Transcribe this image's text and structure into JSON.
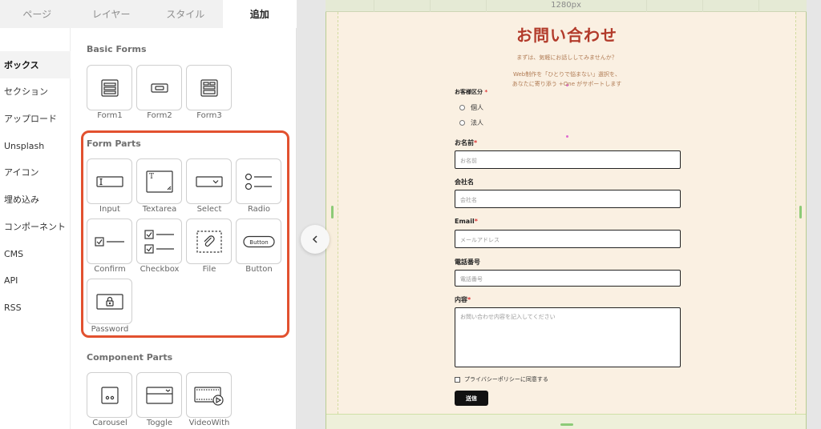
{
  "tabs": [
    {
      "label": "ページ"
    },
    {
      "label": "レイヤー"
    },
    {
      "label": "スタイル"
    },
    {
      "label": "追加",
      "active": true
    }
  ],
  "categories": [
    {
      "label": "ボックス",
      "active": true
    },
    {
      "label": "セクション"
    },
    {
      "label": "アップロード"
    },
    {
      "label": "Unsplash"
    },
    {
      "label": "アイコン"
    },
    {
      "label": "埋め込み"
    },
    {
      "label": "コンポーネント"
    },
    {
      "label": "CMS"
    },
    {
      "label": "API"
    },
    {
      "label": "RSS"
    }
  ],
  "basic_forms": {
    "title": "Basic Forms",
    "items": [
      {
        "label": "Form1",
        "icon": "form1-icon"
      },
      {
        "label": "Form2",
        "icon": "form2-icon"
      },
      {
        "label": "Form3",
        "icon": "form3-icon"
      }
    ]
  },
  "form_parts": {
    "title": "Form Parts",
    "highlight_color": "#e2512f",
    "items": [
      {
        "label": "Input",
        "icon": "input-icon"
      },
      {
        "label": "Textarea",
        "icon": "textarea-icon"
      },
      {
        "label": "Select",
        "icon": "select-icon"
      },
      {
        "label": "Radio",
        "icon": "radio-icon"
      },
      {
        "label": "Confirm",
        "icon": "confirm-icon"
      },
      {
        "label": "Checkbox",
        "icon": "checkbox-icon"
      },
      {
        "label": "File",
        "icon": "file-icon"
      },
      {
        "label": "Button",
        "icon": "button-icon",
        "icon_text": "Button"
      },
      {
        "label": "Password",
        "icon": "password-icon"
      }
    ]
  },
  "component_parts": {
    "title": "Component Parts",
    "items": [
      {
        "label": "Carousel",
        "icon": "carousel-icon"
      },
      {
        "label": "Toggle",
        "icon": "toggle-icon"
      },
      {
        "label": "VideoWith",
        "icon": "video-icon"
      }
    ]
  },
  "canvas": {
    "ruler_label": "1280px"
  },
  "form": {
    "title": "お問い合わせ",
    "title_color": "#b23a2a",
    "subtitle": "まずは、気軽にお話ししてみませんか？",
    "desc1": "Web制作を「ひとりで悩まない」選択を、",
    "desc2": "あなたに寄り添う +One がサポートします",
    "customer_type": {
      "label": "お客様区分",
      "required_mark": "*",
      "options": [
        "個人",
        "法人"
      ]
    },
    "name": {
      "label": "お名前",
      "required_mark": "*",
      "placeholder": "お名前"
    },
    "company": {
      "label": "会社名",
      "placeholder": "会社名"
    },
    "email": {
      "label": "Email",
      "required_mark": "*",
      "placeholder": "メールアドレス"
    },
    "phone": {
      "label": "電話番号",
      "placeholder": "電話番号"
    },
    "content": {
      "label": "内容",
      "required_mark": "*",
      "placeholder": "お問い合わせ内容を記入してください"
    },
    "privacy": "プライバシーポリシーに同意する",
    "submit": "送信"
  }
}
